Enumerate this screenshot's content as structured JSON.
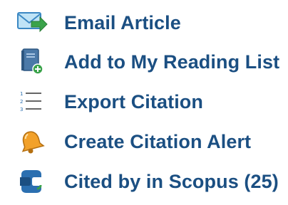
{
  "menu": {
    "items": [
      {
        "label": "Email Article",
        "icon": "email-icon"
      },
      {
        "label": "Add to My Reading List",
        "icon": "reading-list-icon"
      },
      {
        "label": "Export Citation",
        "icon": "export-citation-icon"
      },
      {
        "label": "Create Citation Alert",
        "icon": "bell-icon"
      },
      {
        "label": "Cited by in Scopus (25)",
        "icon": "scopus-icon"
      }
    ]
  },
  "colors": {
    "link": "#1b4f82",
    "green": "#3aa34a",
    "book": "#3f6d9c",
    "bell": "#f2a12a",
    "scopus": "#2b6fb0"
  }
}
